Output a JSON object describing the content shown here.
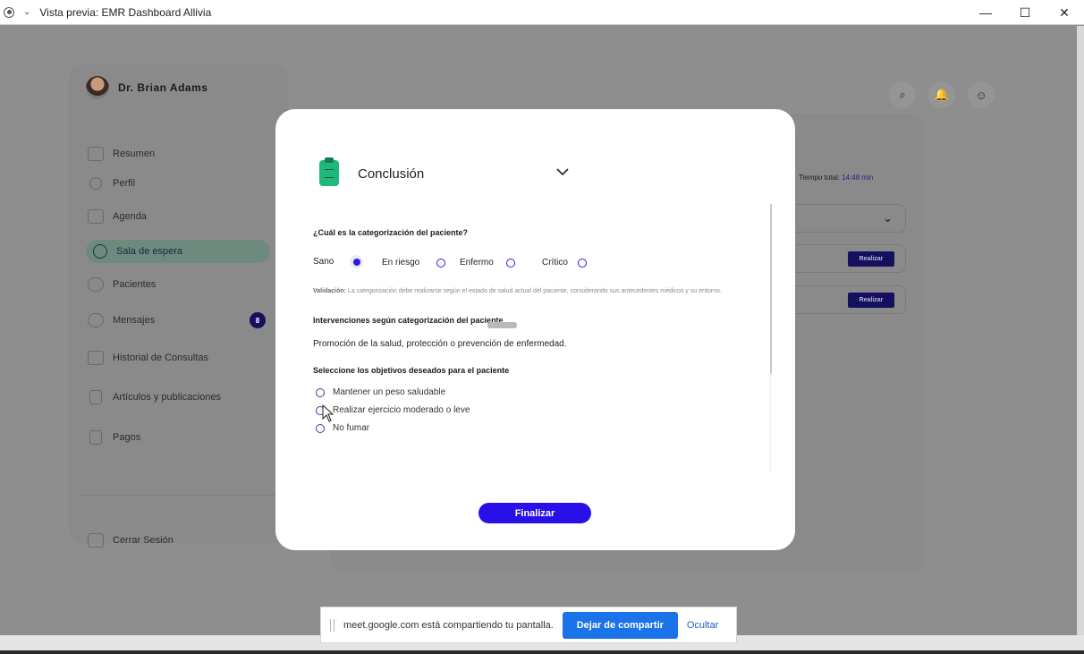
{
  "window": {
    "title": "Vista previa: EMR Dashboard Allivia",
    "minimize": "—",
    "maximize": "☐",
    "close": "✕"
  },
  "sidebar": {
    "doctor_name": "Dr. Brian Adams",
    "items": [
      {
        "label": "Resumen",
        "icon": "grid-icon"
      },
      {
        "label": "Perfil",
        "icon": "user-icon"
      },
      {
        "label": "Agenda",
        "icon": "calendar-icon"
      },
      {
        "label": "Sala de espera",
        "icon": "clock-icon",
        "active": true
      },
      {
        "label": "Pacientes",
        "icon": "users-icon"
      },
      {
        "label": "Mensajes",
        "icon": "chat-icon",
        "badge": "8"
      },
      {
        "label": "Historial de Consultas",
        "icon": "archive-icon"
      },
      {
        "label": "Artículos y publicaciones",
        "icon": "document-icon"
      },
      {
        "label": "Pagos",
        "icon": "receipt-icon"
      }
    ],
    "logout": "Cerrar Sesión"
  },
  "background_panel": {
    "tiempo_label": "Tiempo total:",
    "tiempo_value": "14:48 min",
    "realizar_1": "Realizar",
    "realizar_2": "Realizar"
  },
  "modal": {
    "title": "Conclusión",
    "question_category": "¿Cuál es la categorización del paciente?",
    "categories": [
      "Sano",
      "En riesgo",
      "Enfermo",
      "Crítico"
    ],
    "selected_category": "Sano",
    "validation_label": "Validación:",
    "validation_text": "La categorización debe realizarse según el estado de salud actual del paciente, considerando sus antecedentes médicos y su entorno.",
    "interventions_heading": "Intervenciones según categorización del paciente",
    "interventions_text": "Promoción de la salud, protección o prevención de enfermedad.",
    "goals_heading": "Seleccione los objetivos deseados para el paciente",
    "goals": [
      "Mantener un peso saludable",
      "Realizar ejercicio moderado o leve",
      "No fumar"
    ],
    "finalize": "Finalizar"
  },
  "share_bar": {
    "text": "meet.google.com está compartiendo tu pantalla.",
    "stop": "Dejar de compartir",
    "hide": "Ocultar"
  },
  "colors": {
    "accent": "#2a10e8",
    "conclusion_icon": "#1fb77a",
    "share_button": "#1a73e8"
  }
}
